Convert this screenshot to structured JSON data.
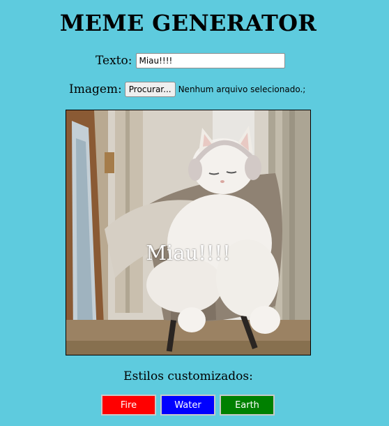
{
  "header": {
    "title": "MEME GENERATOR"
  },
  "text_field": {
    "label": "Texto:",
    "value": "Miau!!!!"
  },
  "image_field": {
    "label": "Imagem:",
    "button_label": "Procurar...",
    "status": "Nenhum arquivo selecionado.;"
  },
  "meme": {
    "caption": "Miau!!!!",
    "image_subject": "white-cat-with-headphones-in-armchair"
  },
  "styles": {
    "label": "Estilos customizados:",
    "buttons": [
      {
        "label": "Fire",
        "color": "#ff0000"
      },
      {
        "label": "Water",
        "color": "#0000ff"
      },
      {
        "label": "Earth",
        "color": "#008000"
      }
    ]
  },
  "colors": {
    "background": "#5ecbde"
  }
}
